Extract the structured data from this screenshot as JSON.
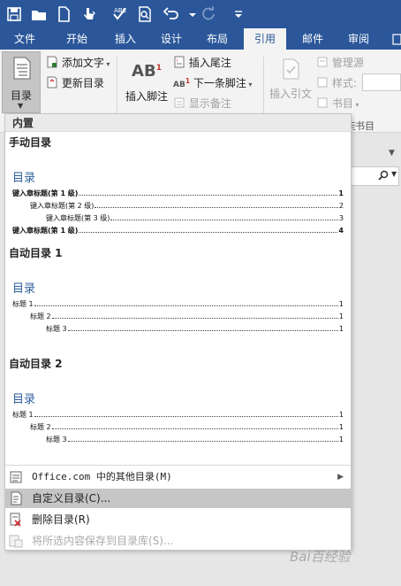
{
  "tabs": [
    {
      "label": "文件",
      "active": false
    },
    {
      "label": "开始",
      "active": false
    },
    {
      "label": "插入",
      "active": false
    },
    {
      "label": "设计",
      "active": false
    },
    {
      "label": "布局",
      "active": false
    },
    {
      "label": "引用",
      "active": true
    },
    {
      "label": "邮件",
      "active": false
    },
    {
      "label": "审阅",
      "active": false
    }
  ],
  "ribbon": {
    "toc_label": "目录",
    "add_text": "添加文字",
    "update_toc": "更新目录",
    "insert_footnote": "插入脚注",
    "insert_endnote": "插入尾注",
    "next_footnote": "下一条脚注",
    "show_notes": "显示备注",
    "insert_citation": "插入引文",
    "manage_sources": "管理源",
    "style": "样式:",
    "bibliography": "书目",
    "group_fragment": "书目"
  },
  "menu": {
    "header": "内置",
    "galleries": [
      {
        "title": "手动目录",
        "heading": "目录",
        "lines": [
          {
            "text": "键入章标题(第 1 级)",
            "page": "1",
            "level": 1,
            "bold": true
          },
          {
            "text": "键入章标题(第 2 级)",
            "page": "2",
            "level": 2,
            "bold": false
          },
          {
            "text": "键入章标题(第 3 级)",
            "page": "3",
            "level": 3,
            "bold": false
          },
          {
            "text": "键入章标题(第 1 级)",
            "page": "4",
            "level": 1,
            "bold": true
          }
        ]
      },
      {
        "title": "自动目录 1",
        "heading": "目录",
        "lines": [
          {
            "text": "标题 1",
            "page": "1",
            "level": 1,
            "bold": false
          },
          {
            "text": "标题 2",
            "page": "1",
            "level": 2,
            "bold": false
          },
          {
            "text": "标题 3",
            "page": "1",
            "level": 3,
            "bold": false
          }
        ]
      },
      {
        "title": "自动目录 2",
        "heading": "目录",
        "lines": [
          {
            "text": "标题 1",
            "page": "1",
            "level": 1,
            "bold": false
          },
          {
            "text": "标题 2",
            "page": "1",
            "level": 2,
            "bold": false
          },
          {
            "text": "标题 3",
            "page": "1",
            "level": 3,
            "bold": false
          }
        ]
      }
    ],
    "items": [
      {
        "label": "Office.com 中的其他目录(M)",
        "has_submenu": true,
        "highlighted": false,
        "disabled": false
      },
      {
        "label": "自定义目录(C)...",
        "has_submenu": false,
        "highlighted": true,
        "disabled": false
      },
      {
        "label": "删除目录(R)",
        "has_submenu": false,
        "highlighted": false,
        "disabled": false
      },
      {
        "label": "将所选内容保存到目录库(S)...",
        "has_submenu": false,
        "highlighted": false,
        "disabled": true
      }
    ]
  },
  "watermark": "Bai百经验",
  "colors": {
    "accent": "#2b579a",
    "toc_heading": "#2e5f9a",
    "highlight": "#c6c6c6"
  }
}
